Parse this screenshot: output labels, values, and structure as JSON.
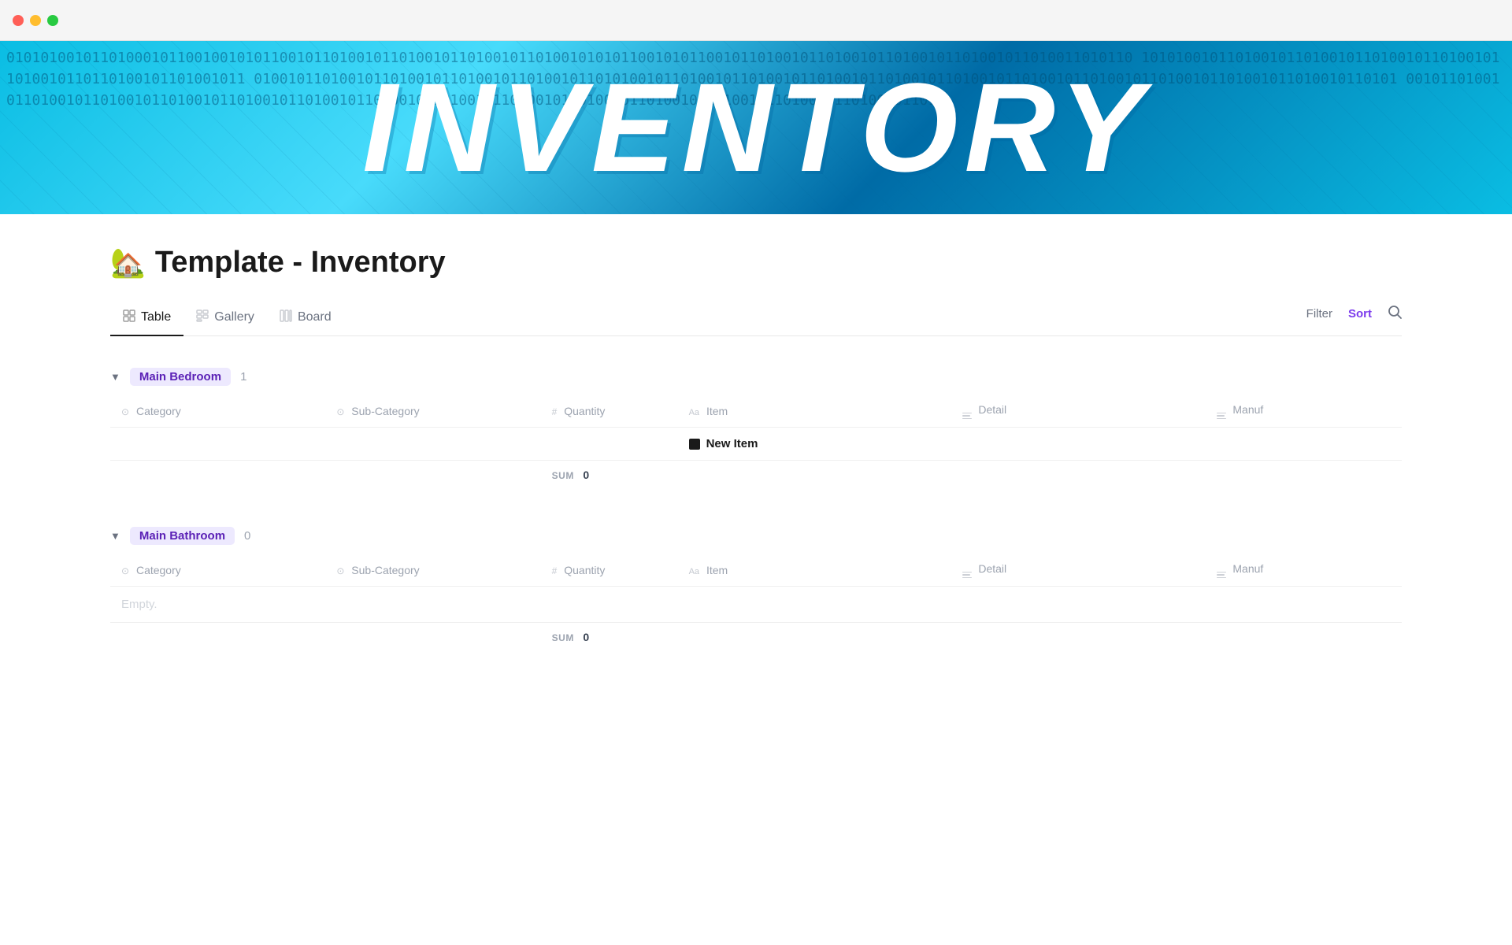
{
  "titlebar": {
    "buttons": {
      "close": "close",
      "minimize": "minimize",
      "maximize": "maximize"
    }
  },
  "hero": {
    "title": "INVENTORY",
    "binary_text": "0101010010110100010110010010101100101101001011010010110100101010110010101100101101001011010010110100101101001011010011010110 1010100101101001011010010110100101101001011010010110110100101101001011 01001011010010110100101101001011010010110101001011010010110100101101001011010010110100101101001011010010110100101101001011010"
  },
  "page": {
    "icon": "🏡",
    "title": "Template - Inventory"
  },
  "tabs": {
    "items": [
      {
        "label": "Table",
        "icon": "⊞",
        "active": true
      },
      {
        "label": "Gallery",
        "icon": "⊟",
        "active": false
      },
      {
        "label": "Board",
        "icon": "⊠",
        "active": false
      }
    ],
    "actions": {
      "filter": "Filter",
      "sort": "Sort",
      "search": "🔍"
    }
  },
  "groups": [
    {
      "id": "main-bedroom",
      "name": "Main Bedroom",
      "count": "1",
      "badge_class": "badge-bedroom",
      "columns": [
        {
          "icon": "⊙",
          "label": "Category"
        },
        {
          "icon": "⊙",
          "label": "Sub-Category"
        },
        {
          "icon": "#",
          "label": "Quantity"
        },
        {
          "icon": "Aa",
          "label": "Item"
        },
        {
          "icon": "≡",
          "label": "Detail"
        },
        {
          "icon": "≡",
          "label": "Manuf"
        }
      ],
      "rows": [
        {
          "type": "new-item",
          "category": "",
          "subcategory": "",
          "quantity": "",
          "item": "New Item",
          "detail": "",
          "manuf": ""
        }
      ],
      "sum_label": "SUM",
      "sum_value": "0"
    },
    {
      "id": "main-bathroom",
      "name": "Main Bathroom",
      "count": "0",
      "badge_class": "badge-bathroom",
      "columns": [
        {
          "icon": "⊙",
          "label": "Category"
        },
        {
          "icon": "⊙",
          "label": "Sub-Category"
        },
        {
          "icon": "#",
          "label": "Quantity"
        },
        {
          "icon": "Aa",
          "label": "Item"
        },
        {
          "icon": "≡",
          "label": "Detail"
        },
        {
          "icon": "≡",
          "label": "Manuf"
        }
      ],
      "rows": [],
      "empty_label": "Empty.",
      "sum_label": "SUM",
      "sum_value": "0"
    }
  ]
}
